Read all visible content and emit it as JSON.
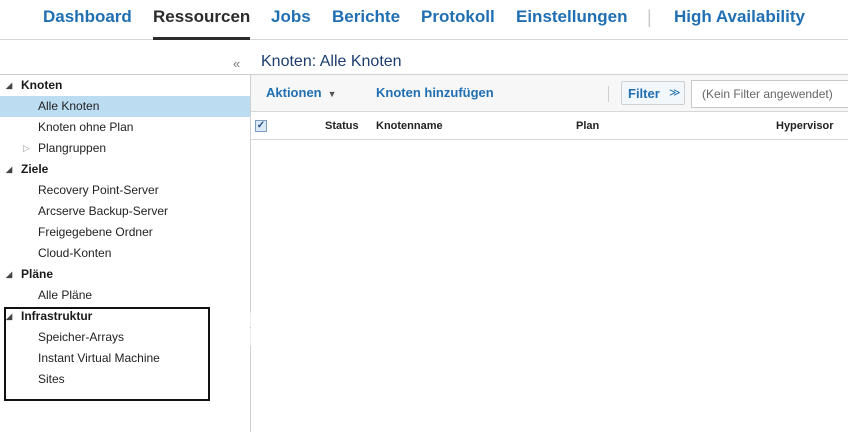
{
  "nav": {
    "tabs": [
      "Dashboard",
      "Ressourcen",
      "Jobs",
      "Berichte",
      "Protokoll",
      "Einstellungen",
      "High Availability"
    ],
    "active_tab": "Ressourcen",
    "separator": "|"
  },
  "sidebar": {
    "collapse_glyph": "«",
    "groups": [
      {
        "label": "Knoten",
        "items": [
          "Alle Knoten",
          "Knoten ohne Plan",
          "Plangruppen"
        ]
      },
      {
        "label": "Ziele",
        "items": [
          "Recovery Point-Server",
          "Arcserve Backup-Server",
          "Freigegebene Ordner",
          "Cloud-Konten"
        ]
      },
      {
        "label": "Pläne",
        "items": [
          "Alle Pläne"
        ]
      },
      {
        "label": "Infrastruktur",
        "items": [
          "Speicher-Arrays",
          "Instant Virtual Machine",
          "Sites"
        ]
      }
    ],
    "selected_item": "Alle Knoten"
  },
  "main": {
    "title": "Knoten: Alle Knoten",
    "toolbar": {
      "actions_label": "Aktionen",
      "add_nodes_label": "Knoten hinzufügen",
      "filter_label": "Filter",
      "filter_placeholder": "(Kein Filter angewendet)"
    },
    "columns": [
      "Status",
      "Knotenname",
      "Plan",
      "Hypervisor"
    ]
  },
  "colors": {
    "link": "#1f6fb2",
    "selected_row": "#bcdcf1",
    "title": "#1c3d6e"
  }
}
